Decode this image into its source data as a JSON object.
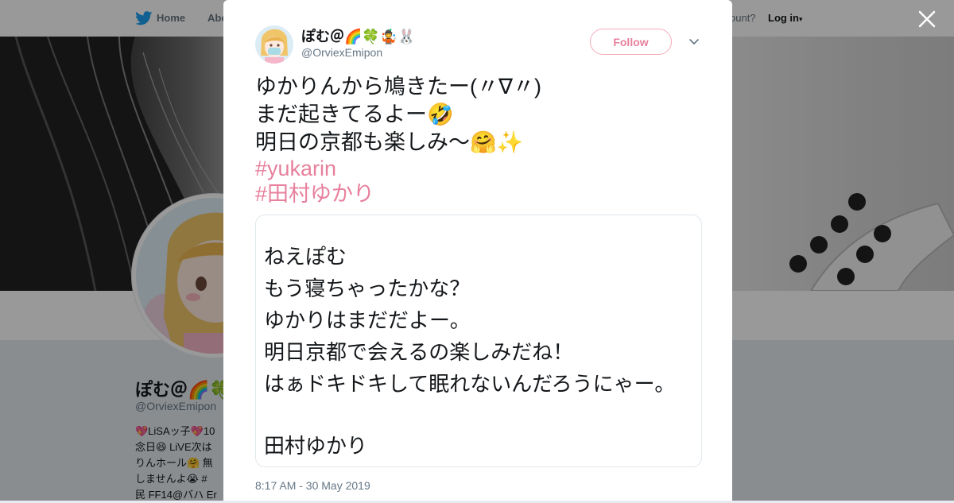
{
  "nav": {
    "home_label": "Home",
    "about_label": "Abo",
    "account_text": "ccount?",
    "login_label": "Log in"
  },
  "background_profile": {
    "name": "ぽむ＠🌈🍀",
    "handle": "@OrviexEmipon",
    "bio_lines": [
      "💖LiSAッ子💖10",
      "念日😆 LiVE次は",
      "りんホール🤗 無",
      "しませんよ😭 #",
      "民  FF14@バハ Er"
    ]
  },
  "tweet": {
    "display_name": "ぽむ＠🌈🍀🤹🐰",
    "handle": "@OrviexEmipon",
    "follow_label": "Follow",
    "lines": [
      "ゆかりんから鳩きたー(〃∇〃)",
      "まだ起きてるよー🤣",
      "明日の京都も楽しみ～🤗✨"
    ],
    "hashtags": [
      "#yukarin",
      "#田村ゆかり"
    ],
    "card_lines": [
      "ねえぽむ",
      "もう寝ちゃったかな？",
      "ゆかりはまだだよー。",
      "明日京都で会えるの楽しみだね！",
      "はぁドキドキして眠れないんだろうにゃー。",
      "",
      "田村ゆかり"
    ],
    "timestamp": "8:17 AM - 30 May 2019"
  },
  "colors": {
    "accent_pink": "#e7809d",
    "text": "#14171a",
    "muted": "#657786",
    "overlay": "rgba(0,0,0,0.4)"
  },
  "icons": [
    "twitter-bird-icon",
    "close-icon",
    "chevron-down-icon",
    "caret-down-icon"
  ]
}
